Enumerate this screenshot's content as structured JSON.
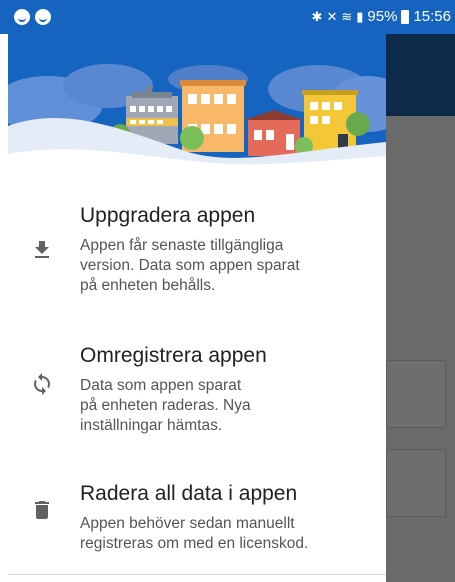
{
  "status_bar": {
    "battery": "95%",
    "time": "15:56"
  },
  "menu": {
    "items": [
      {
        "title": "Uppgradera appen",
        "description": "Appen får senaste tillgängliga\nversion. Data som appen sparat\npå enheten behålls.",
        "icon": "download-icon"
      },
      {
        "title": "Omregistrera appen",
        "description": "Data som appen sparat\npå enheten raderas. Nya\ninställningar hämtas.",
        "icon": "refresh-icon"
      },
      {
        "title": "Radera all data i appen",
        "description": "Appen behöver sedan manuellt\nregistreras om med en licenskod.",
        "icon": "trash-icon"
      }
    ]
  },
  "colors": {
    "status_bar": "#1565c0",
    "overlay": "#6a6a6a",
    "icon": "#616161"
  }
}
